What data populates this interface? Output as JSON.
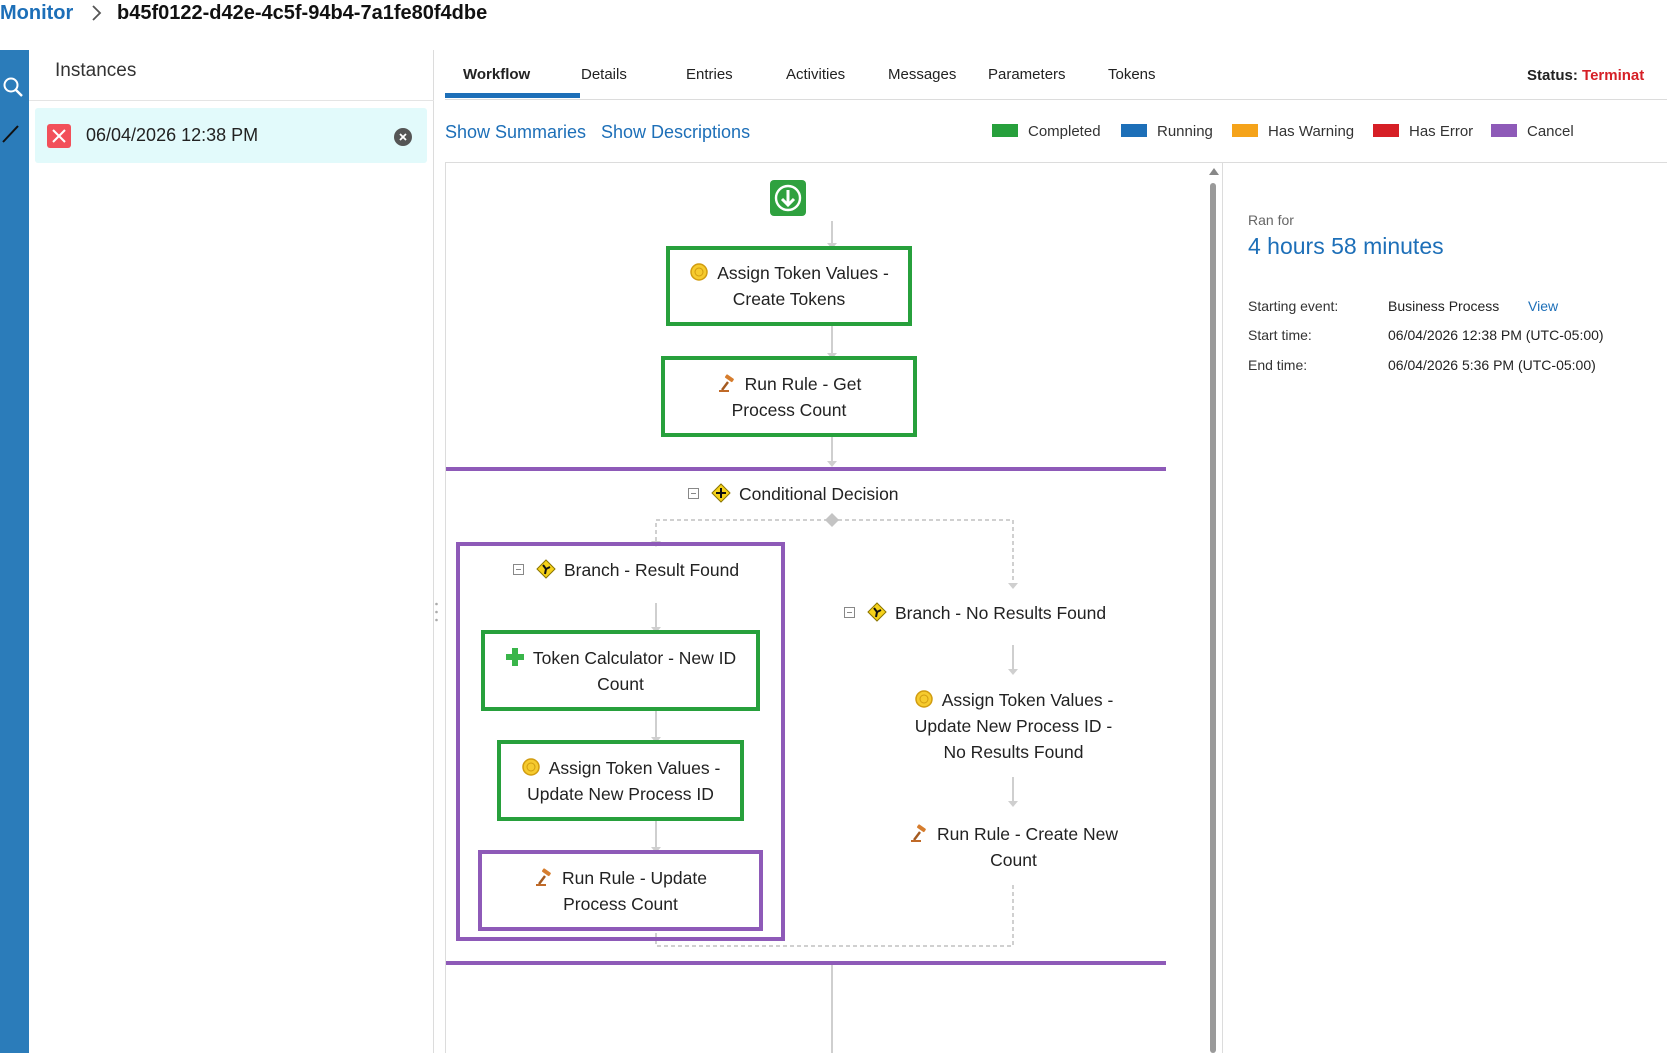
{
  "breadcrumb": {
    "root": "Monitor",
    "current": "b45f0122-d42e-4c5f-94b4-7a1fe80f4dbe"
  },
  "left_rail": {
    "icons": [
      "search-icon",
      "check-icon"
    ]
  },
  "instances": {
    "title": "Instances",
    "items": [
      {
        "date": "06/04/2026 12:38 PM",
        "status_icon": "error-x-icon",
        "status_color": "#f2505a"
      }
    ]
  },
  "tabs": [
    {
      "label": "Workflow",
      "active": true
    },
    {
      "label": "Details",
      "active": false
    },
    {
      "label": "Entries",
      "active": false
    },
    {
      "label": "Activities",
      "active": false
    },
    {
      "label": "Messages",
      "active": false
    },
    {
      "label": "Parameters",
      "active": false
    },
    {
      "label": "Tokens",
      "active": false
    }
  ],
  "status": {
    "label": "Status:",
    "value": "Terminat"
  },
  "toolbar": {
    "show_summaries": "Show Summaries",
    "show_descriptions": "Show Descriptions"
  },
  "legend": [
    {
      "label": "Completed",
      "color": "#27a03c"
    },
    {
      "label": "Running",
      "color": "#1d6fb8"
    },
    {
      "label": "Has Warning",
      "color": "#f5a31a"
    },
    {
      "label": "Has Error",
      "color": "#d61f26"
    },
    {
      "label": "Cancel",
      "color": "#8e5ab8"
    }
  ],
  "workflow": {
    "start_icon": "start-download-icon",
    "nodes": {
      "assign_create": {
        "label": "Assign Token Values - Create Tokens",
        "icon": "token-coin-icon",
        "state": "Completed"
      },
      "run_get_count": {
        "label": "Run Rule - Get Process Count",
        "icon": "gavel-icon",
        "state": "Completed"
      },
      "decision": {
        "label": "Conditional Decision",
        "icon": "decision-diamond-icon"
      },
      "branch_found": {
        "label": "Branch - Result Found",
        "icon": "branch-diamond-icon"
      },
      "branch_none": {
        "label": "Branch - No Results Found",
        "icon": "branch-diamond-icon"
      },
      "token_calc": {
        "label": "Token Calculator - New ID Count",
        "icon": "plus-calculator-icon",
        "state": "Completed"
      },
      "assign_update": {
        "label": "Assign Token Values - Update New Process ID",
        "icon": "token-coin-icon",
        "state": "Completed"
      },
      "run_update": {
        "label": "Run Rule - Update Process Count",
        "icon": "gavel-icon",
        "state": "Cancel"
      },
      "assign_none": {
        "label": "Assign Token Values - Update New Process ID - No Results Found",
        "icon": "token-coin-icon"
      },
      "run_create": {
        "label": "Run Rule - Create New Count",
        "icon": "gavel-icon"
      }
    }
  },
  "details": {
    "ran_for_label": "Ran for",
    "ran_for_value": "4 hours 58 minutes",
    "starting_event_label": "Starting event:",
    "starting_event_value": "Business Process",
    "view_link": "View",
    "start_time_label": "Start time:",
    "start_time_value": "06/04/2026 12:38 PM (UTC-05:00)",
    "end_time_label": "End time:",
    "end_time_value": "06/04/2026 5:36 PM (UTC-05:00)"
  }
}
